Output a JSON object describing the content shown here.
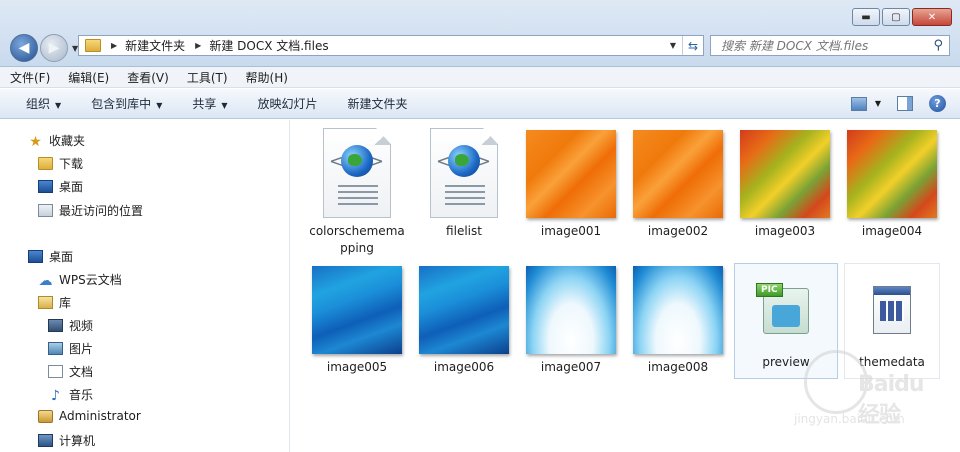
{
  "window": {
    "min_label": "▬",
    "max_label": "▢",
    "close_label": "✕"
  },
  "address": {
    "crumbs": [
      "新建文件夹",
      "新建 DOCX 文档.files"
    ]
  },
  "search": {
    "placeholder": "搜索 新建 DOCX 文档.files"
  },
  "menu": [
    "文件(F)",
    "编辑(E)",
    "查看(V)",
    "工具(T)",
    "帮助(H)"
  ],
  "toolbar": {
    "organize": "组织",
    "include_library": "包含到库中",
    "share": "共享",
    "slideshow": "放映幻灯片",
    "new_folder": "新建文件夹"
  },
  "sidebar": {
    "favorites": "收藏夹",
    "downloads": "下载",
    "desktop_fav": "桌面",
    "recent": "最近访问的位置",
    "desktop": "桌面",
    "wps": "WPS云文档",
    "library": "库",
    "video": "视频",
    "pictures": "图片",
    "documents": "文档",
    "music": "音乐",
    "admin": "Administrator",
    "computer": "计算机"
  },
  "files": [
    {
      "name": "colorschememapping",
      "type": "xml"
    },
    {
      "name": "filelist",
      "type": "xml"
    },
    {
      "name": "image001",
      "type": "orange"
    },
    {
      "name": "image002",
      "type": "orange"
    },
    {
      "name": "image003",
      "type": "multi"
    },
    {
      "name": "image004",
      "type": "multi"
    },
    {
      "name": "image005",
      "type": "blue"
    },
    {
      "name": "image006",
      "type": "blue"
    },
    {
      "name": "image007",
      "type": "light"
    },
    {
      "name": "image008",
      "type": "light"
    },
    {
      "name": "preview",
      "type": "pic"
    },
    {
      "name": "themedata",
      "type": "theme"
    }
  ],
  "colors": {
    "accent": "#2c62a8",
    "selection": "#f4f9fe"
  },
  "watermark": {
    "text": "Baidu经验",
    "url": "jingyan.baidu.com"
  }
}
